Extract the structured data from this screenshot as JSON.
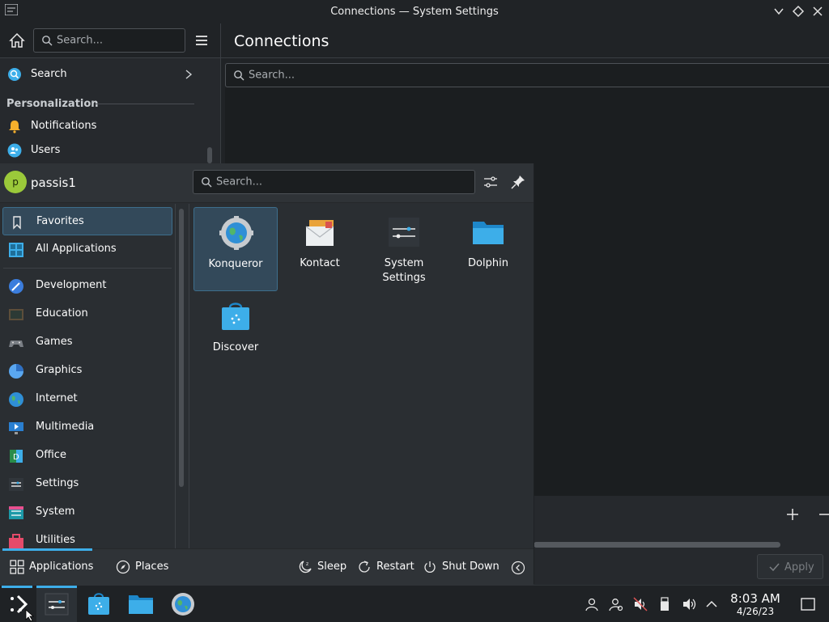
{
  "window": {
    "title": "Connections — System Settings"
  },
  "settings": {
    "search_placeholder": "Search...",
    "page_title": "Connections",
    "content_search_placeholder": "Search...",
    "sidebar": {
      "search_item": "Search",
      "category": "Personalization",
      "items": [
        {
          "label": "Notifications",
          "icon": "bell-icon"
        },
        {
          "label": "Users",
          "icon": "users-icon"
        }
      ]
    },
    "apply_label": "Apply"
  },
  "launcher": {
    "username": "passis1",
    "avatar_letter": "p",
    "search_placeholder": "Search...",
    "categories_top": [
      {
        "label": "Favorites",
        "icon": "bookmark-icon",
        "selected": true
      },
      {
        "label": "All Applications",
        "icon": "grid-icon",
        "selected": false
      }
    ],
    "categories": [
      {
        "label": "Development",
        "icon": "development-icon"
      },
      {
        "label": "Education",
        "icon": "education-icon"
      },
      {
        "label": "Games",
        "icon": "gamepad-icon"
      },
      {
        "label": "Graphics",
        "icon": "graphics-icon"
      },
      {
        "label": "Internet",
        "icon": "globe-icon"
      },
      {
        "label": "Multimedia",
        "icon": "multimedia-icon"
      },
      {
        "label": "Office",
        "icon": "office-icon"
      },
      {
        "label": "Settings",
        "icon": "settings-icon"
      },
      {
        "label": "System",
        "icon": "system-icon"
      },
      {
        "label": "Utilities",
        "icon": "utilities-icon"
      }
    ],
    "apps": [
      {
        "label": "Konqueror",
        "icon": "konqueror-icon",
        "selected": true
      },
      {
        "label": "Kontact",
        "icon": "kontact-icon",
        "selected": false
      },
      {
        "label": "System Settings",
        "icon": "system-settings-icon",
        "selected": false
      },
      {
        "label": "Dolphin",
        "icon": "dolphin-folder-icon",
        "selected": false
      },
      {
        "label": "Discover",
        "icon": "discover-icon",
        "selected": false
      }
    ],
    "footer": {
      "applications": "Applications",
      "places": "Places",
      "sleep": "Sleep",
      "restart": "Restart",
      "shutdown": "Shut Down"
    }
  },
  "taskbar": {
    "time": "8:03 AM",
    "date": "4/26/23"
  },
  "colors": {
    "accent": "#3daee9",
    "selection": "#33495a",
    "panel": "#2a2e32"
  }
}
